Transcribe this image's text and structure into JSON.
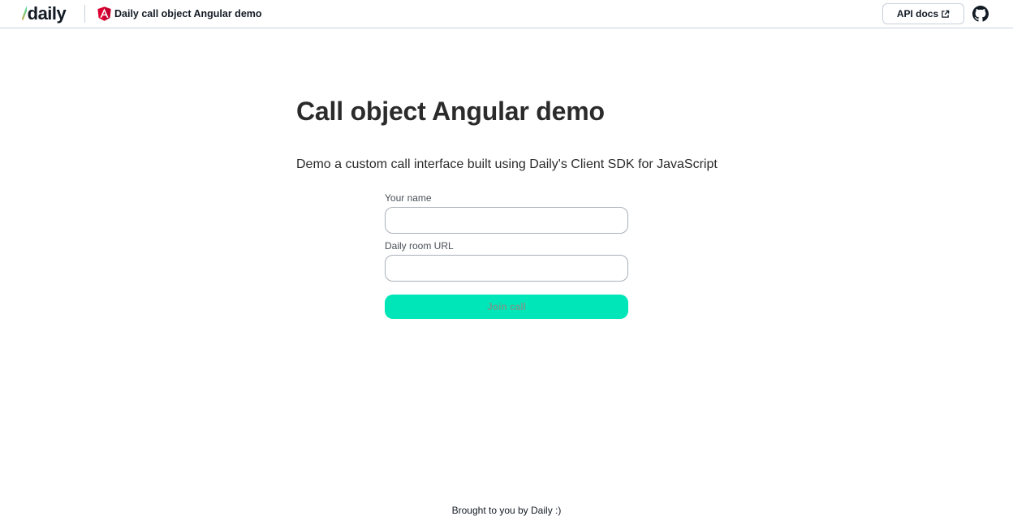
{
  "header": {
    "logo_text": "daily",
    "title": "Daily call object Angular demo",
    "api_docs_label": "API docs",
    "icons": {
      "brand": "angular-icon",
      "external": "external-link-icon",
      "github": "github-icon"
    }
  },
  "main": {
    "title": "Call object Angular demo",
    "subtitle": "Demo a custom call interface built using Daily's Client SDK for JavaScript",
    "form": {
      "name_label": "Your name",
      "name_value": "",
      "url_label": "Daily room URL",
      "url_value": "",
      "join_label": "Join call"
    }
  },
  "footer": {
    "text": "Brought to you by Daily :)"
  },
  "colors": {
    "accent": "#00e6b8",
    "angular_red": "#dd0031",
    "border": "#c8d1dc"
  }
}
